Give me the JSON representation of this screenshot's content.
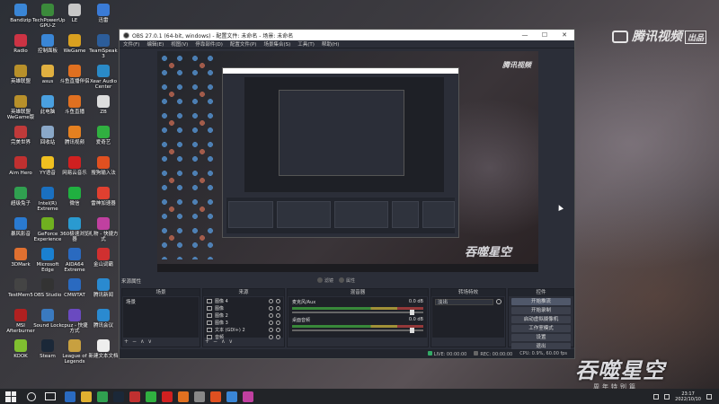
{
  "desktop": {
    "icons": [
      {
        "label": "Bandizip",
        "color": "#3a86d6"
      },
      {
        "label": "TechPowerUp GPU-Z",
        "color": "#3b8a3b"
      },
      {
        "label": "LE",
        "color": "#c7c7c7"
      },
      {
        "label": "迅雷",
        "color": "#3a7bd6"
      },
      {
        "label": "Radio",
        "color": "#cc3344"
      },
      {
        "label": "控制面板",
        "color": "#3a86d6"
      },
      {
        "label": "WeGame",
        "color": "#d9a020"
      },
      {
        "label": "TeamSpeak 3",
        "color": "#2c5d9a"
      },
      {
        "label": "英雄联盟",
        "color": "#b8902a"
      },
      {
        "label": "asus",
        "color": "#e0b040"
      },
      {
        "label": "斗鱼直播伴侣",
        "color": "#e07020"
      },
      {
        "label": "Xear Audio Center",
        "color": "#2a8ac8"
      },
      {
        "label": "英雄联盟 WeGame版",
        "color": "#b8902a"
      },
      {
        "label": "此电脑",
        "color": "#4aa0e0"
      },
      {
        "label": "斗鱼直播",
        "color": "#e07020"
      },
      {
        "label": "ZB",
        "color": "#ddd"
      },
      {
        "label": "完美世界",
        "color": "#c03a3a"
      },
      {
        "label": "回收站",
        "color": "#8aa8c8"
      },
      {
        "label": "腾讯视频",
        "color": "#e58020"
      },
      {
        "label": "爱奇艺",
        "color": "#30b040"
      },
      {
        "label": "Aim Hero",
        "color": "#c03030"
      },
      {
        "label": "YY语音",
        "color": "#f0c020"
      },
      {
        "label": "网易云音乐",
        "color": "#d02020"
      },
      {
        "label": "搜狗输入法",
        "color": "#e05020"
      },
      {
        "label": "超级兔子",
        "color": "#30a050"
      },
      {
        "label": "Intel(R) Extreme",
        "color": "#1a70c0"
      },
      {
        "label": "微信",
        "color": "#20b040"
      },
      {
        "label": "雷神加速器",
        "color": "#e04030"
      },
      {
        "label": "暴风影音",
        "color": "#2a7ad0"
      },
      {
        "label": "GeForce Experience",
        "color": "#70b020"
      },
      {
        "label": "360极速浏览器",
        "color": "#2a9ad0"
      },
      {
        "label": "礼物 - 快捷方式",
        "color": "#c040a0"
      },
      {
        "label": "3DMark",
        "color": "#e07030"
      },
      {
        "label": "Microsoft Edge",
        "color": "#1a80d0"
      },
      {
        "label": "AIDA64 Extreme",
        "color": "#2a6ac0"
      },
      {
        "label": "金山词霸",
        "color": "#d03030"
      },
      {
        "label": "TestMem5",
        "color": "#444"
      },
      {
        "label": "OBS Studio",
        "color": "#333"
      },
      {
        "label": "CMWTAT",
        "color": "#2a6ac0"
      },
      {
        "label": "腾讯新闻",
        "color": "#2a8ad0"
      },
      {
        "label": "MSI Afterburner",
        "color": "#b02020"
      },
      {
        "label": "Sound Lock",
        "color": "#3a7ac0"
      },
      {
        "label": "cpuz - 快捷方式",
        "color": "#6a4ac0"
      },
      {
        "label": "腾讯会议",
        "color": "#2a8ad0"
      },
      {
        "label": "KOOK",
        "color": "#80c030"
      },
      {
        "label": "Steam",
        "color": "#1b2838"
      },
      {
        "label": "League of Legends",
        "color": "#c8a040"
      },
      {
        "label": "新建文本文档",
        "color": "#eee"
      },
      {
        "label": "超级录屏",
        "color": "#d03030"
      }
    ],
    "watermark_text": "腾讯视频",
    "watermark_badge": "出品",
    "logo_text": "吞噬星空",
    "logo_sub": "周年特别篇"
  },
  "obs": {
    "title": "OBS 27.0.1 (64-bit, windows) - 配置文件: 未命名 - 场景: 未命名",
    "menu": [
      "文件(F)",
      "编辑(E)",
      "视图(V)",
      "停靠部件(D)",
      "配置文件(P)",
      "场景集合(S)",
      "工具(T)",
      "帮助(H)"
    ],
    "window_buttons": [
      "—",
      "☐",
      "✕"
    ],
    "current_scene_label": "来源属性",
    "transition_buttons": [
      "滤镜",
      "属性"
    ],
    "docks": {
      "scenes": {
        "title": "场景",
        "items": [
          "场景"
        ]
      },
      "sources": {
        "title": "来源",
        "items": [
          "图像 4",
          "图像",
          "图像 2",
          "图像 3",
          "文本 (GDI+) 2",
          "音频"
        ]
      },
      "mixer": {
        "title": "混音器",
        "rows": [
          {
            "name": "桌面音频",
            "db": "0.0 dB"
          },
          {
            "name": "麦克风/Aux",
            "db": "0.0 dB"
          }
        ]
      },
      "transitions": {
        "title": "转场特效",
        "selected": "淡出"
      },
      "controls": {
        "title": "控件",
        "buttons": [
          "开始推流",
          "开始录制",
          "启动虚拟摄像机",
          "工作室模式",
          "设置",
          "退出"
        ]
      }
    },
    "footer_symbols": [
      "+",
      "−",
      "∧",
      "∨"
    ],
    "status": {
      "live": "LIVE: 00:00:00",
      "rec": "REC: 00:00:00",
      "cpu": "CPU: 0.9%, 60.00 fps"
    }
  },
  "taskbar": {
    "time": "23:17",
    "date": "2022/10/10",
    "app_colors": [
      "#2a6ac0",
      "#e0b030",
      "#30a050",
      "#1b2838",
      "#c03030",
      "#30b040",
      "#d02020",
      "#e07020",
      "#888",
      "#e05020",
      "#3a86d6",
      "#c040a0"
    ]
  }
}
